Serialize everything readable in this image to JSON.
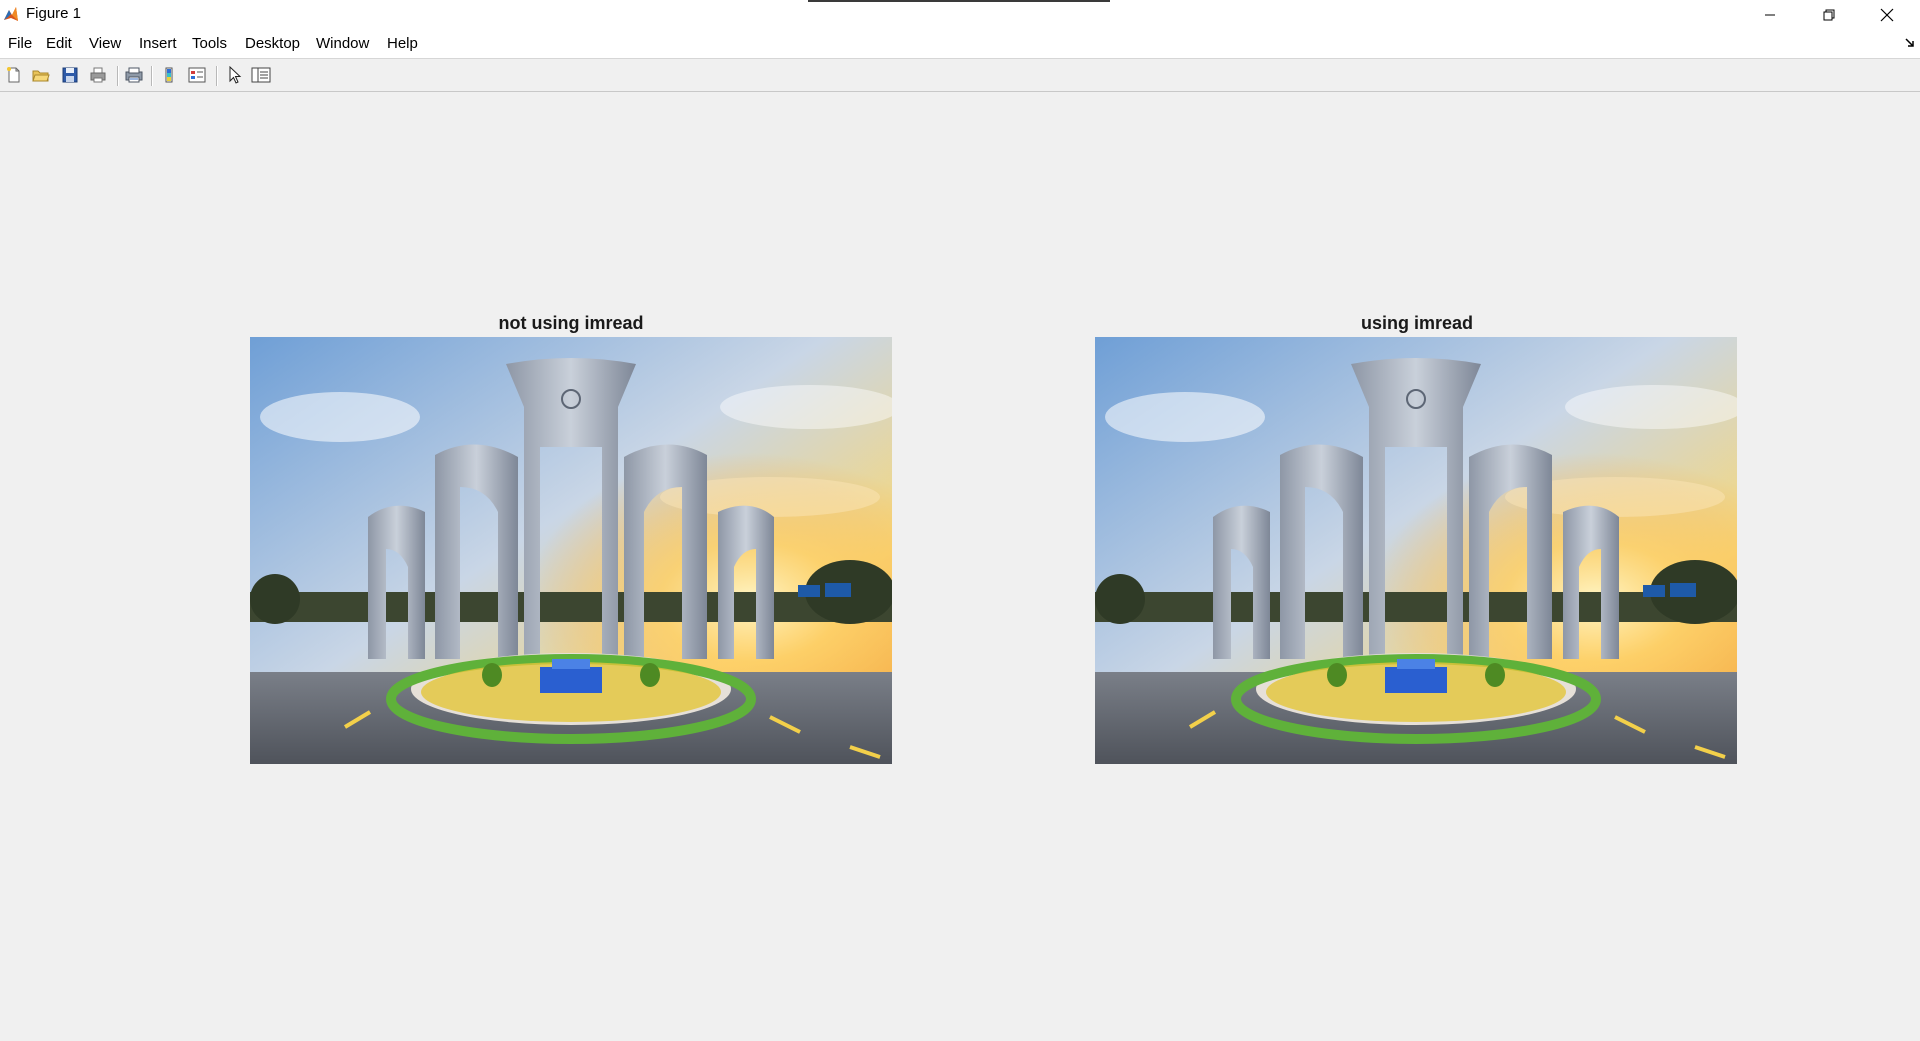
{
  "window": {
    "title": "Figure 1"
  },
  "menu": {
    "items": [
      "File",
      "Edit",
      "View",
      "Insert",
      "Tools",
      "Desktop",
      "Window",
      "Help"
    ]
  },
  "toolbar": {
    "buttons": [
      {
        "name": "new-figure",
        "icon": "new-file-icon"
      },
      {
        "name": "open-file",
        "icon": "open-folder-icon"
      },
      {
        "name": "save-figure",
        "icon": "save-icon"
      },
      {
        "name": "print-figure",
        "icon": "print-icon"
      },
      {
        "name": "print-preview",
        "icon": "print-preview-icon"
      },
      {
        "name": "insert-colorbar",
        "icon": "colorbar-icon"
      },
      {
        "name": "insert-legend",
        "icon": "legend-icon"
      },
      {
        "name": "edit-plot",
        "icon": "pointer-arrow-icon"
      },
      {
        "name": "show-plot-tools",
        "icon": "plot-tools-icon"
      }
    ]
  },
  "axes": [
    {
      "title": "not using imread"
    },
    {
      "title": "using imread"
    }
  ],
  "colors": {
    "background": "#f0f0f0",
    "title_bar": "#ffffff",
    "sky_top": "#7fa8d8",
    "sky_sunset": "#f5c24a",
    "monument": "#a9b3c2",
    "road": "#5a5e66"
  }
}
